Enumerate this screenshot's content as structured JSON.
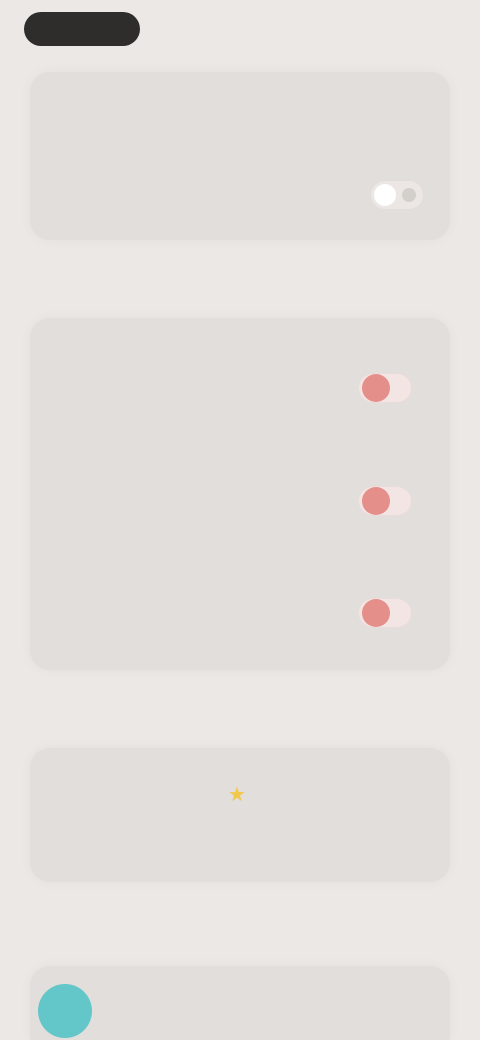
{
  "top_pill": {
    "label": ""
  },
  "card1": {
    "section_label": "",
    "title": "",
    "subtitle": "",
    "toggle_on": false
  },
  "notifications": {
    "section_label": "",
    "items": [
      {
        "title": "",
        "subtitle": "",
        "toggle_on": true
      },
      {
        "title": "",
        "subtitle": "",
        "toggle_on": true
      },
      {
        "title": "",
        "subtitle": "",
        "toggle_on": true
      }
    ]
  },
  "feedback": {
    "section_label": "",
    "rate_title": "",
    "rate_icon": "star-icon",
    "share_title": ""
  },
  "bottom": {
    "section_label": "",
    "item_title": ""
  },
  "colors": {
    "background": "#ebe8e5",
    "card": "#e1dedb",
    "accent_toggle": "#e58f8a",
    "star": "#f2c84b",
    "avatar": "#63c6c9"
  }
}
